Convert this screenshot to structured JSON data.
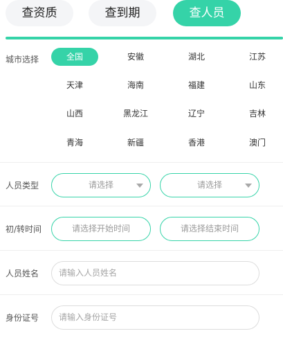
{
  "tabs": [
    {
      "label": "查资质",
      "active": false
    },
    {
      "label": "查到期",
      "active": false
    },
    {
      "label": "查人员",
      "active": true
    }
  ],
  "accent_color": "#35d3a8",
  "city_filter": {
    "label": "城市选择",
    "cities": [
      "全国",
      "安徽",
      "湖北",
      "江苏",
      "天津",
      "海南",
      "福建",
      "山东",
      "山西",
      "黑龙江",
      "辽宁",
      "吉林",
      "青海",
      "新疆",
      "香港",
      "澳门"
    ],
    "selected": "全国"
  },
  "person_type": {
    "label": "人员类型",
    "select_1_placeholder": "请选择",
    "select_2_placeholder": "请选择"
  },
  "time_range": {
    "label": "初/转时间",
    "start_placeholder": "请选择开始时间",
    "end_placeholder": "请选择结束时间"
  },
  "name_field": {
    "label": "人员姓名",
    "placeholder": "请输入人员姓名"
  },
  "id_field": {
    "label": "身份证号",
    "placeholder": "请输入身份证号"
  }
}
